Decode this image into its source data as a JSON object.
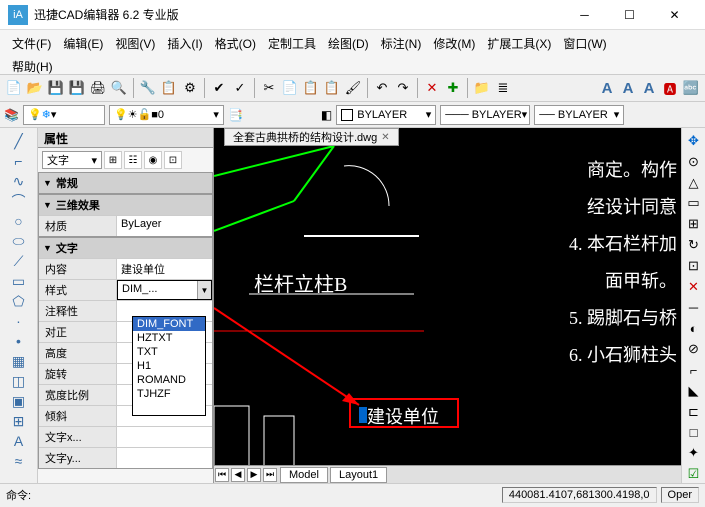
{
  "title": "迅捷CAD编辑器 6.2 专业版",
  "menu": [
    "文件(F)",
    "编辑(E)",
    "视图(V)",
    "插入(I)",
    "格式(O)",
    "定制工具",
    "绘图(D)",
    "标注(N)",
    "修改(M)",
    "扩展工具(X)",
    "窗口(W)",
    "帮助(H)"
  ],
  "layer0": "0",
  "bylayer": "BYLAYER",
  "prop_header": "属性",
  "prop_type": "文字",
  "sections": {
    "general": "常规",
    "effect3d": "三维效果",
    "text": "文字"
  },
  "rows": {
    "material_k": "材质",
    "material_v": "ByLayer",
    "content_k": "内容",
    "content_v": "建设单位",
    "style_k": "样式",
    "style_v": "DIM_...",
    "annot_k": "注释性",
    "align_k": "对正",
    "height_k": "高度",
    "rotate_k": "旋转",
    "width_k": "宽度比例",
    "oblique_k": "倾斜",
    "textx_k": "文字x...",
    "texty_k": "文字y..."
  },
  "style_options": [
    "DIM_FONT",
    "HZTXT",
    "TXT",
    "H1",
    "ROMAND",
    "TJHZF"
  ],
  "tab_file": "全套古典拱桥的结构设计.dwg",
  "cad": {
    "t1": "栏杆立柱B",
    "t2": "建设单位",
    "r1": "商定。构作",
    "r2": "经设计同意",
    "r3": "4. 本石栏杆加",
    "r4": "面甲斩。",
    "r5": "5. 踢脚石与桥",
    "r6": "6. 小石狮柱头"
  },
  "bottom_tabs": {
    "model": "Model",
    "layout1": "Layout1"
  },
  "status": {
    "cmd": "命令:",
    "coords": "440081.4107,681300.4198,0",
    "mode": "Oper"
  }
}
